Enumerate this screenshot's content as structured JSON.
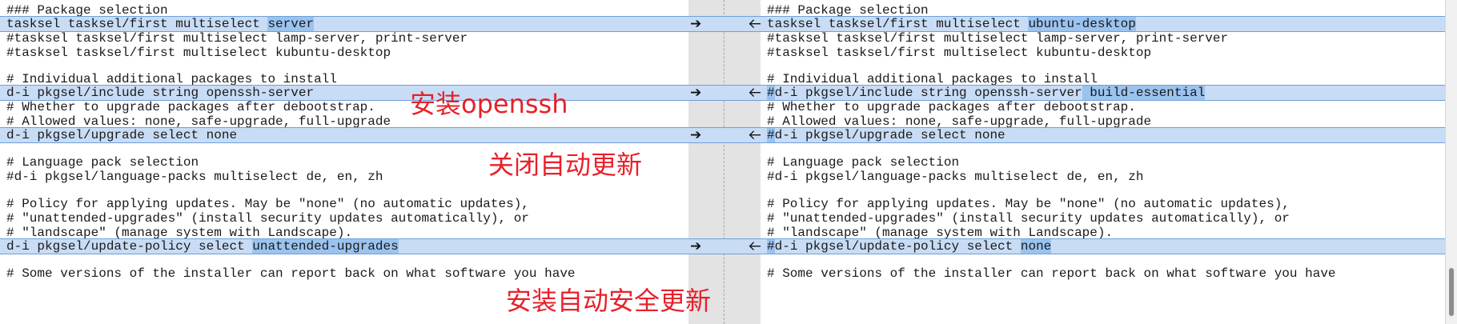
{
  "left_pane": {
    "lines": [
      "### Package selection",
      "tasksel tasksel/first multiselect server",
      "#tasksel tasksel/first multiselect lamp-server, print-server",
      "#tasksel tasksel/first multiselect kubuntu-desktop",
      "",
      "# Individual additional packages to install",
      "d-i pkgsel/include string openssh-server",
      "# Whether to upgrade packages after debootstrap.",
      "# Allowed values: none, safe-upgrade, full-upgrade",
      "d-i pkgsel/upgrade select none",
      "",
      "# Language pack selection",
      "#d-i pkgsel/language-packs multiselect de, en, zh",
      "",
      "# Policy for applying updates. May be \"none\" (no automatic updates),",
      "# \"unattended-upgrades\" (install security updates automatically), or",
      "# \"landscape\" (manage system with Landscape).",
      "d-i pkgsel/update-policy select unattended-upgrades",
      "",
      "# Some versions of the installer can report back on what software you have"
    ],
    "diff_1": {
      "prefix": "tasksel tasksel/first multiselect ",
      "highlight": "server"
    },
    "diff_2": {
      "prefix": "d-i pkgsel/include string openssh-server"
    },
    "diff_3": {
      "prefix": "d-i pkgsel/upgrade select none"
    },
    "diff_4": {
      "prefix": "d-i pkgsel/update-policy select ",
      "highlight": "unattended-upgrades"
    }
  },
  "right_pane": {
    "lines": [
      "### Package selection",
      "tasksel tasksel/first multiselect ubuntu-desktop",
      "#tasksel tasksel/first multiselect lamp-server, print-server",
      "#tasksel tasksel/first multiselect kubuntu-desktop",
      "",
      "# Individual additional packages to install",
      "#d-i pkgsel/include string openssh-server build-essential",
      "# Whether to upgrade packages after debootstrap.",
      "# Allowed values: none, safe-upgrade, full-upgrade",
      "#d-i pkgsel/upgrade select none",
      "",
      "# Language pack selection",
      "#d-i pkgsel/language-packs multiselect de, en, zh",
      "",
      "# Policy for applying updates. May be \"none\" (no automatic updates),",
      "# \"unattended-upgrades\" (install security updates automatically), or",
      "# \"landscape\" (manage system with Landscape).",
      "#d-i pkgsel/update-policy select none",
      "",
      "# Some versions of the installer can report back on what software you have"
    ],
    "diff_1": {
      "prefix": "tasksel tasksel/first multiselect ",
      "highlight": "ubuntu-desktop"
    },
    "diff_2": {
      "hash": "#",
      "prefix": "d-i pkgsel/include string openssh-server",
      "highlight": " build-essential"
    },
    "diff_3": {
      "hash": "#",
      "prefix": "d-i pkgsel/upgrade select none"
    },
    "diff_4": {
      "hash": "#",
      "prefix": "d-i pkgsel/update-policy select ",
      "highlight": "none"
    }
  },
  "gutter": {
    "copy_right_arrow": "➔",
    "copy_left_arrow": "🡐"
  },
  "annotations": {
    "install_openssh": "安装openssh",
    "disable_auto_update": "关闭自动更新",
    "install_auto_security_update": "安装自动安全更新"
  },
  "colors": {
    "diff_band": "#c8dcf5",
    "diff_highlight": "#9bc3ef",
    "annotation_red": "#e8202a",
    "gutter": "#e3e3e3"
  }
}
